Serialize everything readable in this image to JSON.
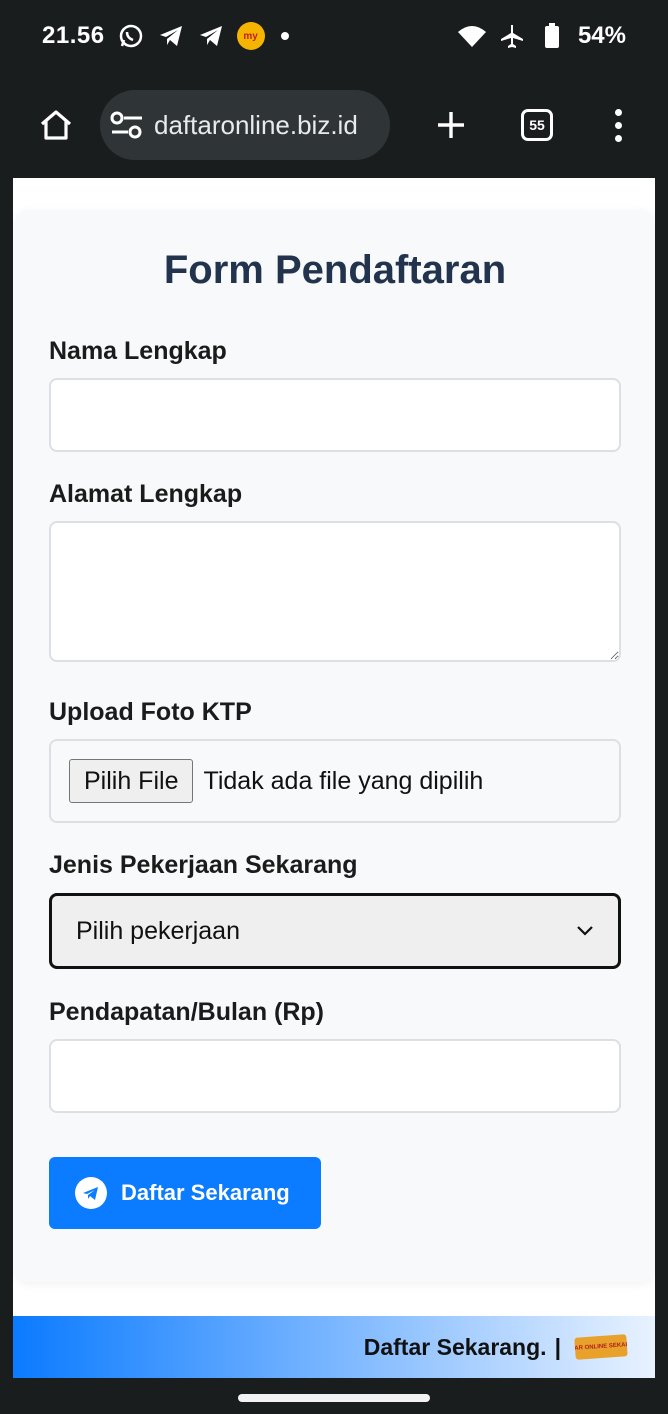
{
  "status_bar": {
    "time": "21.56",
    "battery": "54%",
    "icons_left": [
      "whatsapp-icon",
      "telegram-icon",
      "telegram-icon",
      "mymb-icon",
      "dot-icon"
    ],
    "icons_right": [
      "wifi-icon",
      "airplane-icon",
      "battery-icon"
    ]
  },
  "browser": {
    "url": "daftaronline.biz.id",
    "tab_count": "55"
  },
  "form": {
    "title": "Form Pendaftaran",
    "name_label": "Nama Lengkap",
    "name_value": "",
    "address_label": "Alamat Lengkap",
    "address_value": "",
    "ktp_label": "Upload Foto KTP",
    "file_button": "Pilih File",
    "file_status": "Tidak ada file yang dipilih",
    "job_label": "Jenis Pekerjaan Sekarang",
    "job_selected": "Pilih pekerjaan",
    "income_label": "Pendapatan/Bulan (Rp)",
    "income_value": "",
    "submit_label": "Daftar Sekarang"
  },
  "banner": {
    "text": "Daftar Sekarang.",
    "separator": "|",
    "logo_text": "DAFTAR ONLINE SEKARANG"
  },
  "colors": {
    "accent": "#0b7bff",
    "title": "#22344d",
    "system_bg": "#1a1d1e"
  }
}
